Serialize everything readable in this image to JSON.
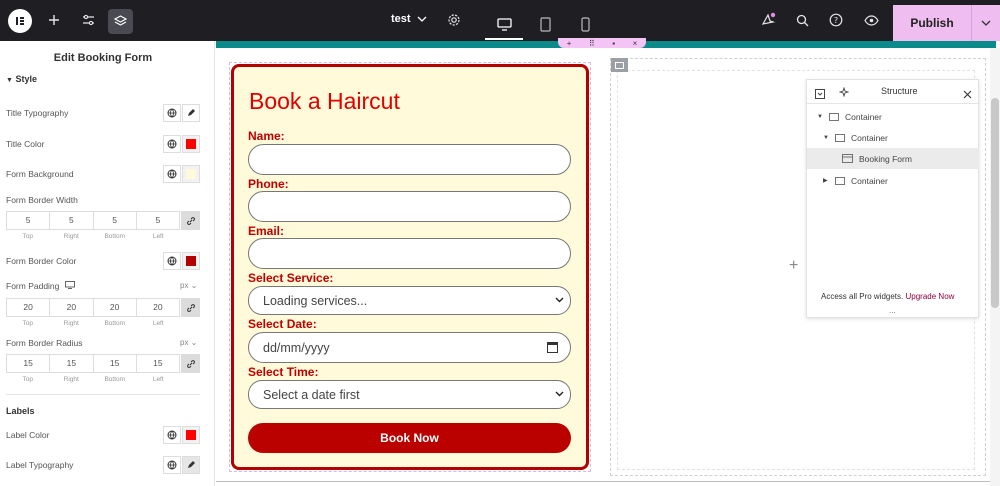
{
  "topbar": {
    "doc_name": "test",
    "publish_label": "Publish"
  },
  "panel": {
    "title": "Edit Booking Form",
    "style_section": "Style",
    "title_typography": "Title Typography",
    "title_color": "Title Color",
    "form_background": "Form Background",
    "form_border_width": "Form Border Width",
    "border_width_values": [
      "5",
      "5",
      "5",
      "5"
    ],
    "side_labels": [
      "Top",
      "Right",
      "Bottom",
      "Left"
    ],
    "form_border_color": "Form Border Color",
    "form_padding": "Form Padding",
    "padding_unit": "px",
    "padding_values": [
      "20",
      "20",
      "20",
      "20"
    ],
    "form_border_radius": "Form Border Radius",
    "radius_unit": "px",
    "radius_values": [
      "15",
      "15",
      "15",
      "15"
    ],
    "labels_section": "Labels",
    "label_color": "Label Color",
    "label_typography": "Label Typography"
  },
  "colors": {
    "title_color": "#e00000",
    "form_background": "#fffad9",
    "border_color": "#b30000",
    "label_color": "#ff0000",
    "accent_teal": "#0b8a8c",
    "publish_bg": "#f0bdf1"
  },
  "form": {
    "title": "Book a Haircut",
    "name_label": "Name:",
    "phone_label": "Phone:",
    "email_label": "Email:",
    "service_label": "Select Service:",
    "service_value": "Loading services...",
    "date_label": "Select Date:",
    "date_placeholder": "dd/mm/yyyy",
    "time_label": "Select Time:",
    "time_value": "Select a date first",
    "submit_label": "Book Now"
  },
  "structure": {
    "title": "Structure",
    "items": [
      "Container",
      "Container",
      "Booking Form",
      "Container"
    ],
    "footer_text": "Access all Pro widgets.",
    "footer_link": "Upgrade Now",
    "more": "..."
  }
}
